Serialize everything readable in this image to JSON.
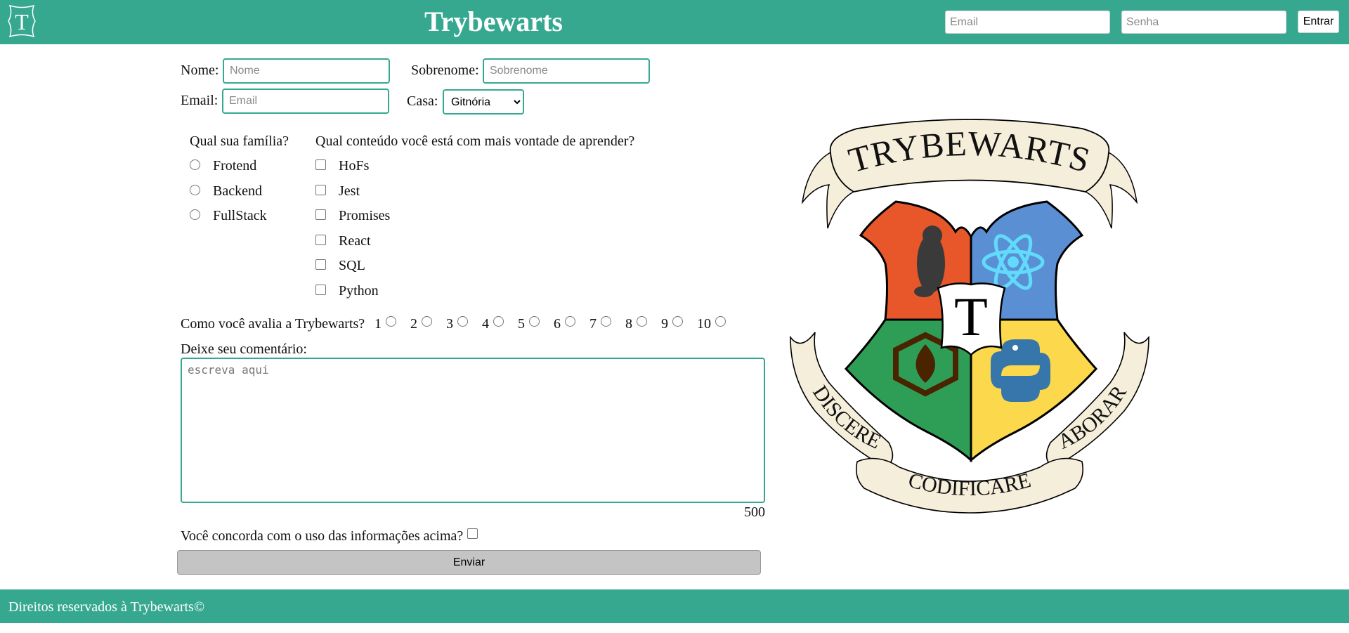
{
  "header": {
    "logo_letter": "T",
    "title": "Trybewarts",
    "login": {
      "email_placeholder": "Email",
      "password_placeholder": "Senha",
      "button_label": "Entrar"
    }
  },
  "form": {
    "name_label": "Nome:",
    "name_placeholder": "Nome",
    "lastname_label": "Sobrenome:",
    "lastname_placeholder": "Sobrenome",
    "email_label": "Email:",
    "email_placeholder": "Email",
    "house_label": "Casa:",
    "house_selected": "Gitnória",
    "family_question": "Qual sua família?",
    "families": [
      "Frotend",
      "Backend",
      "FullStack"
    ],
    "content_question": "Qual conteúdo você está com mais vontade de aprender?",
    "contents": [
      "HoFs",
      "Jest",
      "Promises",
      "React",
      "SQL",
      "Python"
    ],
    "rate_label": "Como você avalia a Trybewarts?",
    "rates": [
      "1",
      "2",
      "3",
      "4",
      "5",
      "6",
      "7",
      "8",
      "9",
      "10"
    ],
    "comment_label": "Deixe seu comentário:",
    "comment_placeholder": "escreva aqui",
    "counter": "500",
    "agree_label": "Você concorda com o uso das informações acima?",
    "submit_label": "Enviar"
  },
  "crest": {
    "banner_top": "TRYBEWARTS",
    "center_letter": "T",
    "motto_left": "DISCERE",
    "motto_bottom": "CODIFICARE",
    "motto_right": "LABORARE",
    "colors": {
      "orange": "#e8572a",
      "blue": "#5b8fd4",
      "green": "#2e9e57",
      "yellow": "#fbd84c",
      "ribbon": "#f5eeda"
    }
  },
  "footer": {
    "text": "Direitos reservados à Trybewarts©"
  },
  "colors": {
    "brand": "#36a890",
    "button_gray": "#c4c4c4"
  }
}
